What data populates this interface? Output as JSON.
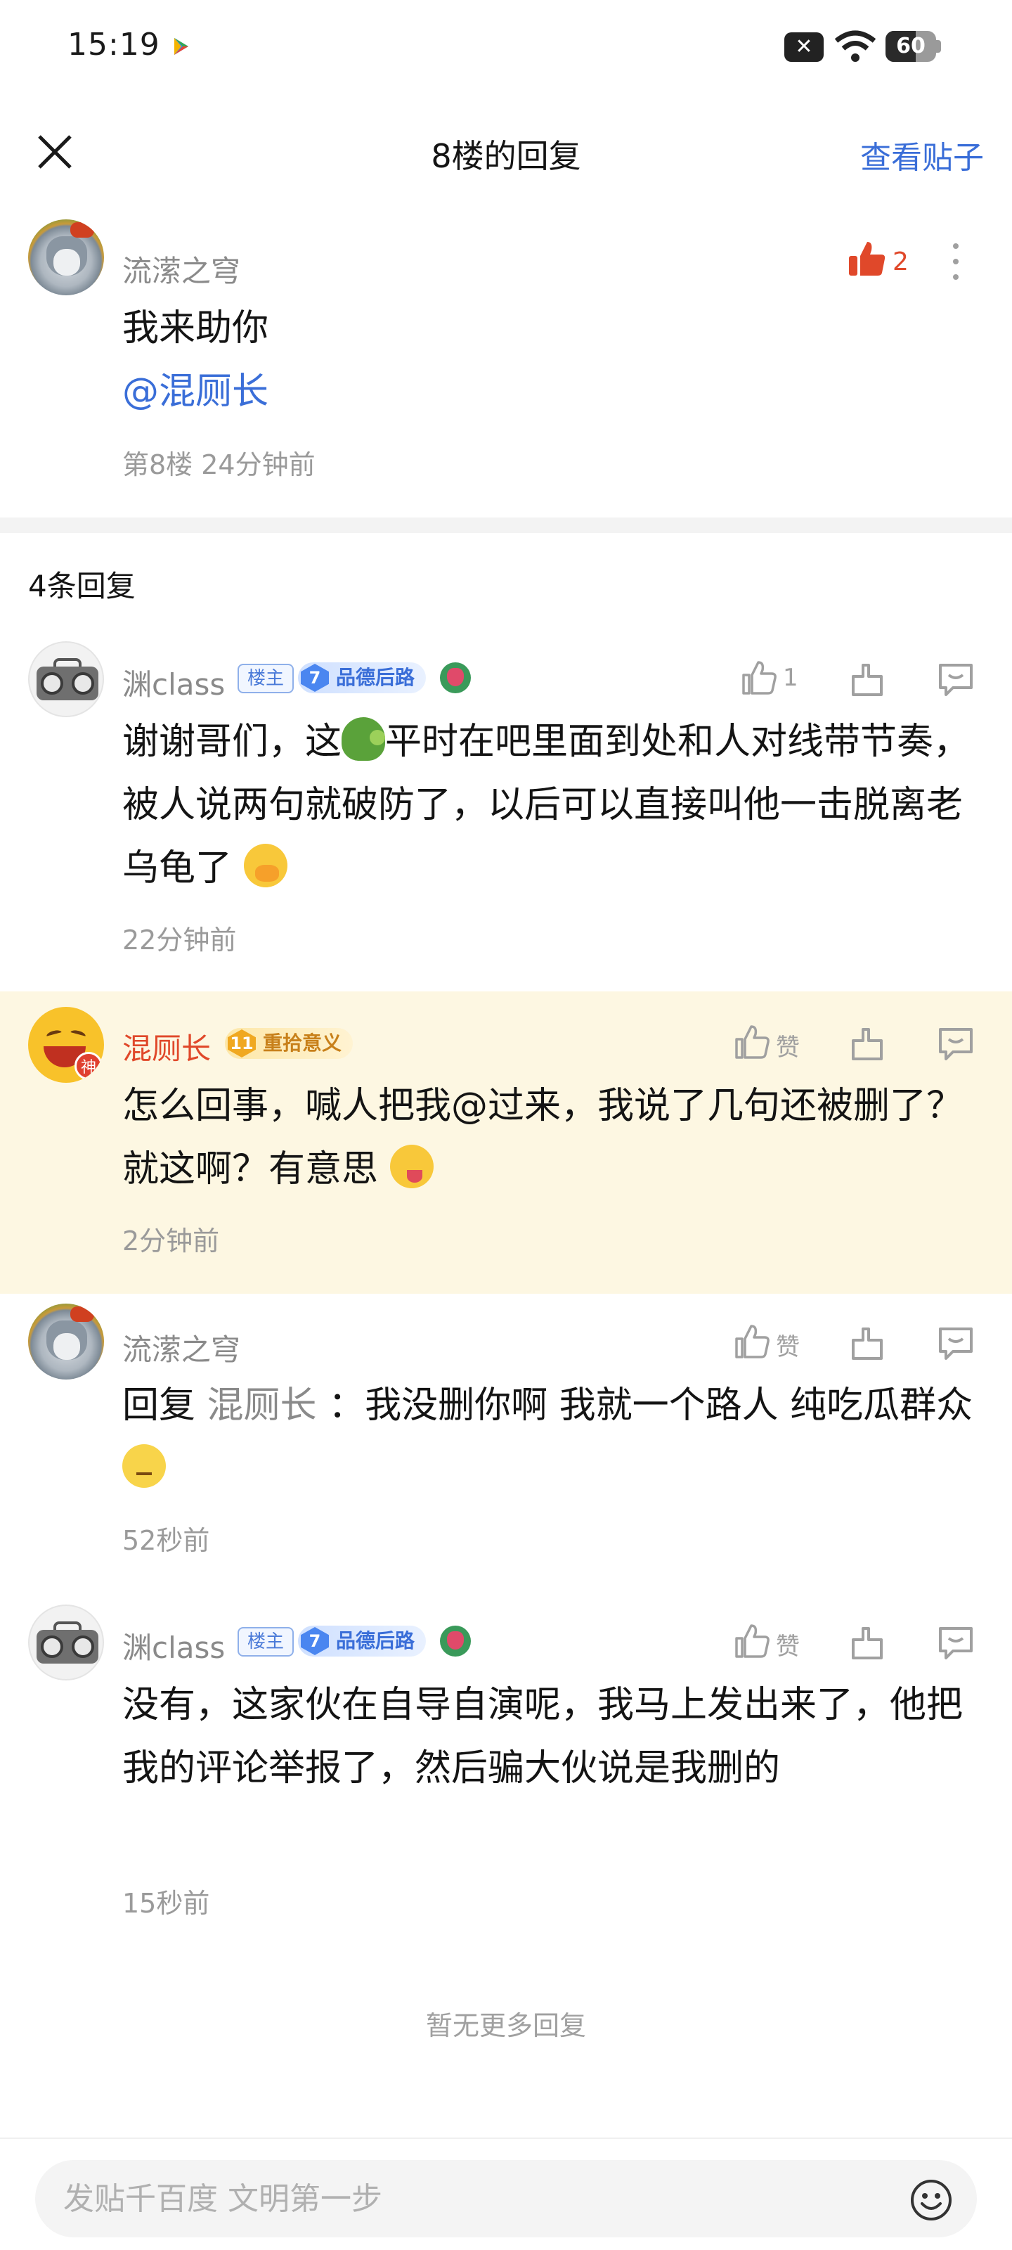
{
  "status": {
    "time": "15:19",
    "battery": "60",
    "battery_level": 0.6
  },
  "header": {
    "title": "8楼的回复",
    "view_post": "查看贴子"
  },
  "floor": {
    "username": "流潆之穹",
    "like_count": "2",
    "line1": "我来助你",
    "mention": "@混厕长",
    "meta": "第8楼 24分钟前"
  },
  "reply_count": "4条回复",
  "replies": [
    {
      "username": "渊class",
      "host_badge": "楼主",
      "level": "7",
      "level_title": "品德后路",
      "like_label": "1",
      "text_a": "谢谢哥们，这",
      "text_b": "平时在吧里面到处和人对线带节奏，被人说两句就破防了，以后可以直接叫他一击脱离老乌龟了",
      "time": "22分钟前"
    },
    {
      "username": "混厕长",
      "level": "11",
      "level_title": "重拾意义",
      "like_label": "赞",
      "text": "怎么回事，喊人把我@过来，我说了几句还被删了？就这啊？有意思",
      "time": "2分钟前"
    },
    {
      "username": "流潆之穹",
      "like_label": "赞",
      "reply_prefix": "回复",
      "reply_to": "混厕长",
      "text": "：我没删你啊 我就一个路人 纯吃瓜群众",
      "time": "52秒前"
    },
    {
      "username": "渊class",
      "host_badge": "楼主",
      "level": "7",
      "level_title": "品德后路",
      "like_label": "赞",
      "text": "没有，这家伙在自导自演呢，我马上发出来了，他把我的评论举报了，然后骗大伙说是我删的",
      "time": "15秒前"
    }
  ],
  "no_more": "暂无更多回复",
  "composer": {
    "placeholder": "发贴千百度 文明第一步"
  },
  "icons": [
    "play-store-icon",
    "notification-x-icon",
    "wifi-icon",
    "battery-icon",
    "close-icon",
    "like-icon",
    "dislike-icon",
    "reply-icon",
    "more-icon",
    "smile-icon"
  ],
  "colors": {
    "accent_blue": "#3a6ed8",
    "like_red": "#e0482a",
    "highlight_bg": "#fdf7e2"
  }
}
